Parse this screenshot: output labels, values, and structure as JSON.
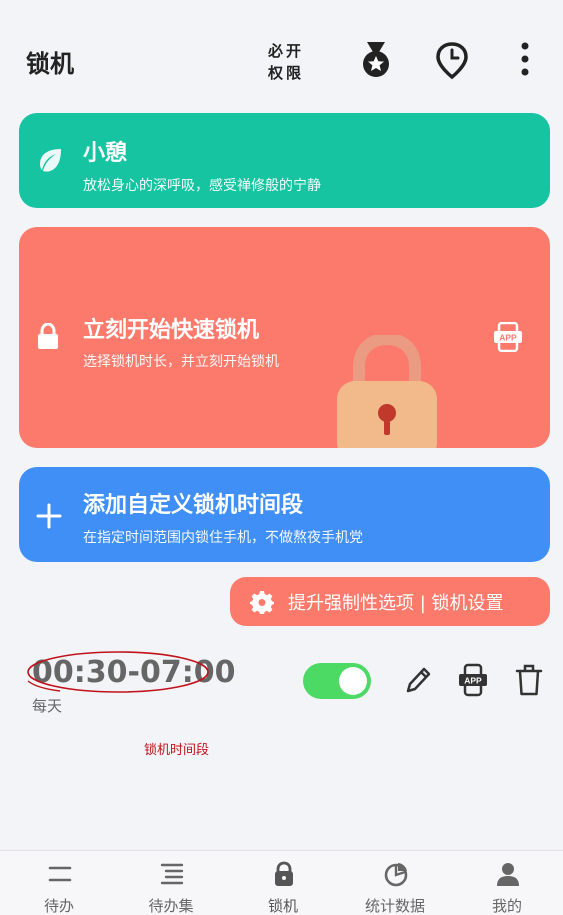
{
  "header": {
    "title": "锁机",
    "permission_line1": "必开",
    "permission_line2": "权限",
    "icons": [
      "medal-icon",
      "clock-icon",
      "more-icon"
    ]
  },
  "cards": {
    "rest": {
      "title": "小憩",
      "subtitle": "放松身心的深呼吸，感受禅修般的宁静",
      "color": "#16c4a2"
    },
    "quick_lock": {
      "title": "立刻开始快速锁机",
      "subtitle": "选择锁机时长，并立刻开始锁机",
      "color": "#fb7a6b"
    },
    "add_period": {
      "title": "添加自定义锁机时间段",
      "subtitle": "在指定时间范围内锁住手机，不做熬夜手机党",
      "color": "#3f8ff7"
    }
  },
  "settings_button": {
    "label": "提升强制性选项 | 锁机设置"
  },
  "schedule": {
    "time_range": "00:30-07:00",
    "repeat": "每天",
    "enabled": true,
    "annotation": "锁机时间段"
  },
  "nav": {
    "items": [
      {
        "label": "待办",
        "icon": "todo-icon"
      },
      {
        "label": "待办集",
        "icon": "todo-list-icon"
      },
      {
        "label": "锁机",
        "icon": "lock-icon"
      },
      {
        "label": "统计数据",
        "icon": "stats-icon"
      },
      {
        "label": "我的",
        "icon": "profile-icon"
      }
    ],
    "active_index": 2
  }
}
